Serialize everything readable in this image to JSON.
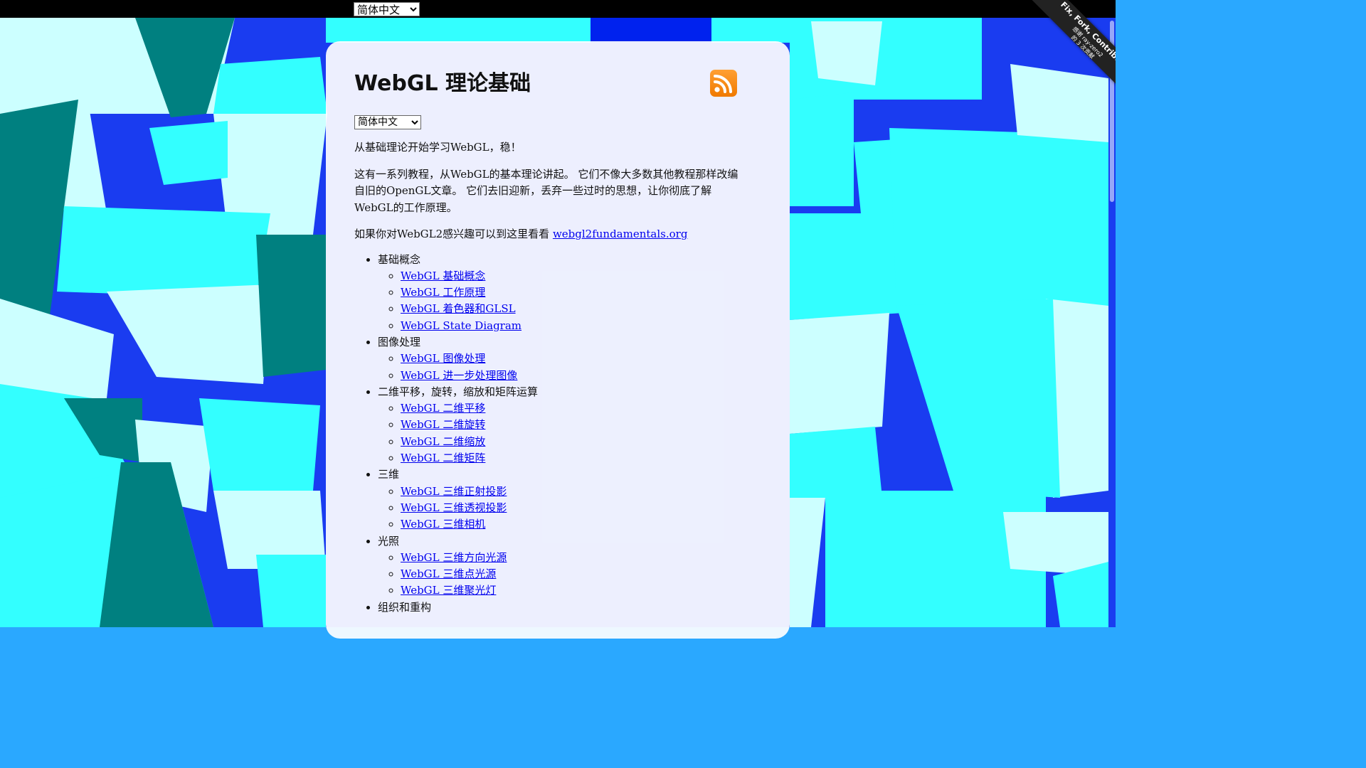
{
  "top_bar": {
    "language_select": {
      "selected": "简体中文",
      "options": [
        "简体中文"
      ]
    }
  },
  "ribbon": {
    "line1": "Fix, Fork, Contribute",
    "line2": "感谢 ray-zero2",
    "line3": "的 3 次贡献"
  },
  "header": {
    "title": "WebGL 理论基础",
    "rss_icon": "rss-icon"
  },
  "language_select": {
    "selected": "简体中文",
    "options": [
      "简体中文"
    ]
  },
  "intro": {
    "p1": "从基础理论开始学习WebGL，稳！",
    "p2": "这有一系列教程，从WebGL的基本理论讲起。 它们不像大多数其他教程那样改编自旧的OpenGL文章。 它们去旧迎新，丢弃一些过时的思想，让你彻底了解WebGL的工作原理。",
    "p3_text": "如果你对WebGL2感兴趣可以到这里看看 ",
    "p3_link": "webgl2fundamentals.org"
  },
  "toc": [
    {
      "label": "基础概念",
      "items": [
        "WebGL 基础概念",
        "WebGL 工作原理",
        "WebGL 着色器和GLSL",
        "WebGL State Diagram"
      ]
    },
    {
      "label": "图像处理",
      "items": [
        "WebGL 图像处理",
        "WebGL 进一步处理图像"
      ]
    },
    {
      "label": "二维平移，旋转，缩放和矩阵运算",
      "items": [
        "WebGL 二维平移",
        "WebGL 二维旋转",
        "WebGL 二维缩放",
        "WebGL 二维矩阵"
      ]
    },
    {
      "label": "三维",
      "items": [
        "WebGL 三维正射投影",
        "WebGL 三维透视投影",
        "WebGL 三维相机"
      ]
    },
    {
      "label": "光照",
      "items": [
        "WebGL 三维方向光源",
        "WebGL 三维点光源",
        "WebGL 三维聚光灯"
      ]
    },
    {
      "label": "组织和重构",
      "items": []
    }
  ],
  "colors": {
    "cube_light": "#33ffff",
    "cube_pale": "#ccffff",
    "cube_teal": "#008080",
    "cube_blue": "#0022ee",
    "link": "#0000ee"
  }
}
